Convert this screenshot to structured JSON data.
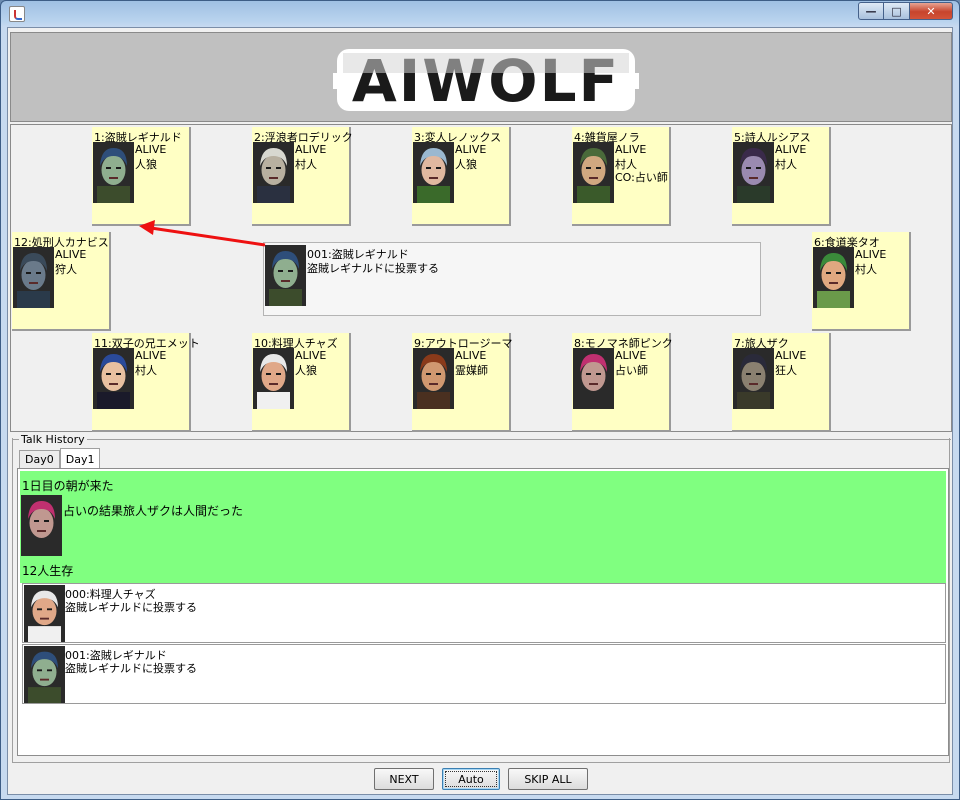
{
  "window": {
    "title": ""
  },
  "banner": {
    "logo_text": "AIWOLF"
  },
  "players_top": [
    {
      "name": "1:盗賊レギナルド",
      "status": "ALIVE",
      "role": "人狼",
      "co": "",
      "skin": "#8fae8f",
      "hair": "#2e4e7a",
      "cloth": "#3c4c2c"
    },
    {
      "name": "2:浮浪者ロデリック",
      "status": "ALIVE",
      "role": "村人",
      "co": "",
      "skin": "#b8b0a0",
      "hair": "#d8d8d0",
      "cloth": "#2a3040"
    },
    {
      "name": "3:変人レノックス",
      "status": "ALIVE",
      "role": "人狼",
      "co": "",
      "skin": "#e0b8a0",
      "hair": "#9ab8d0",
      "cloth": "#3a6a2a"
    },
    {
      "name": "4:雑貨屋ノラ",
      "status": "ALIVE",
      "role": "村人",
      "co": "CO:占い師",
      "skin": "#d0a880",
      "hair": "#4a6a3a",
      "cloth": "#3a5a2a"
    },
    {
      "name": "5:詩人ルシアス",
      "status": "ALIVE",
      "role": "村人",
      "co": "",
      "skin": "#9a8ab0",
      "hair": "#3a2a4a",
      "cloth": "#2a3a2a"
    }
  ],
  "player_left": {
    "name": "12:処刑人カナビス",
    "status": "ALIVE",
    "role": "狩人",
    "co": "",
    "skin": "#6a7a8a",
    "hair": "#3a4a5a",
    "cloth": "#2a3a4a"
  },
  "player_right": {
    "name": "6:食道楽タオ",
    "status": "ALIVE",
    "role": "村人",
    "co": "",
    "skin": "#e0a880",
    "hair": "#3a8a3a",
    "cloth": "#6a9a4a"
  },
  "players_bottom": [
    {
      "name": "11:双子の兄エメット",
      "status": "ALIVE",
      "role": "村人",
      "co": "",
      "skin": "#e8c0a0",
      "hair": "#2a4a9a",
      "cloth": "#1a1a2a"
    },
    {
      "name": "10:料理人チャズ",
      "status": "ALIVE",
      "role": "人狼",
      "co": "",
      "skin": "#e0a888",
      "hair": "#e8e8e8",
      "cloth": "#f0f0f0"
    },
    {
      "name": "9:アウトロージーマ",
      "status": "ALIVE",
      "role": "霊媒師",
      "co": "",
      "skin": "#d09870",
      "hair": "#8a3a1a",
      "cloth": "#4a3020"
    },
    {
      "name": "8:モノマネ師ピンク",
      "status": "ALIVE",
      "role": "占い師",
      "co": "",
      "skin": "#c09890",
      "hair": "#c03070",
      "cloth": "#2a2a2a"
    },
    {
      "name": "7:旅人ザク",
      "status": "ALIVE",
      "role": "狂人",
      "co": "",
      "skin": "#8a8070",
      "hair": "#2a2a3a",
      "cloth": "#3a3a2a"
    }
  ],
  "speech": {
    "name": "001:盗賊レギナルド",
    "text": "盗賊レギナルドに投票する",
    "skin": "#8fae8f",
    "hair": "#2e4e7a",
    "cloth": "#3c4c2c"
  },
  "history": {
    "title": "Talk History",
    "tabs": [
      "Day0",
      "Day1"
    ],
    "active_tab": "Day1",
    "day_title": "1日目の朝が来た",
    "day_message": "占いの結果旅人ザクは人間だった",
    "day_face": {
      "skin": "#c09890",
      "hair": "#c03070",
      "cloth": "#2a2a2a"
    },
    "alive_count": "12人生存",
    "talks": [
      {
        "name": "000:料理人チャズ",
        "text": "盗賊レギナルドに投票する",
        "skin": "#e0a888",
        "hair": "#e8e8e8",
        "cloth": "#f0f0f0"
      },
      {
        "name": "001:盗賊レギナルド",
        "text": "盗賊レギナルドに投票する",
        "skin": "#8fae8f",
        "hair": "#2e4e7a",
        "cloth": "#3c4c2c"
      }
    ]
  },
  "buttons": {
    "next": "NEXT",
    "auto": "Auto",
    "skip_all": "SKIP ALL"
  },
  "colors": {
    "card_bg": "#ffffc4",
    "day_bg": "#80ff80",
    "arrow": "#ee1111"
  }
}
